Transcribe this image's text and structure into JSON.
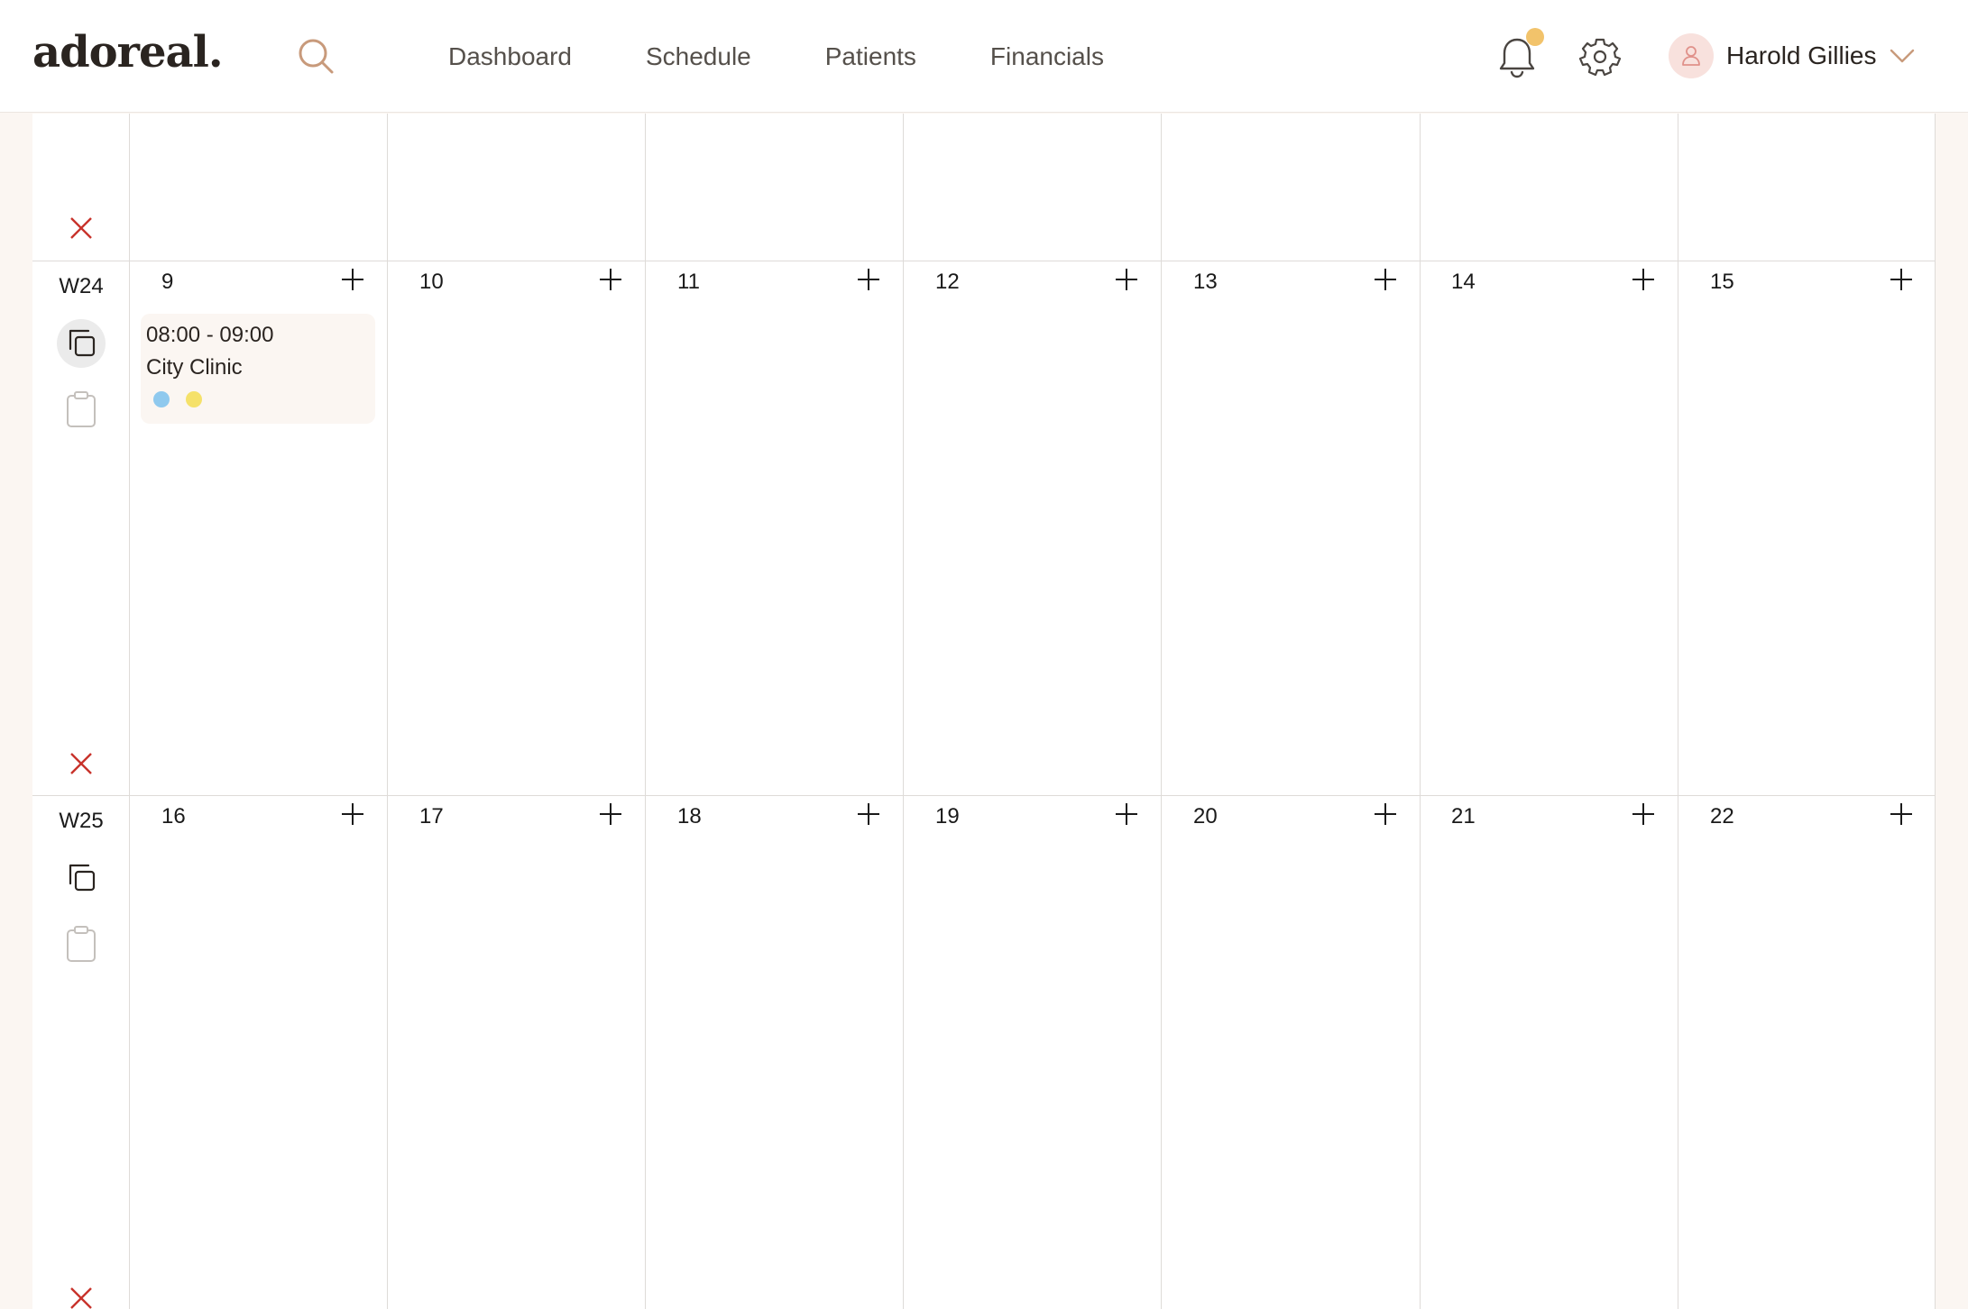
{
  "app": {
    "logo": "adoreal."
  },
  "nav": {
    "items": [
      "Dashboard",
      "Schedule",
      "Patients",
      "Financials"
    ]
  },
  "user": {
    "name": "Harold Gillies"
  },
  "colors": {
    "accent": "#f2c36b",
    "delete": "#c8322b",
    "search": "#c89a7b",
    "dot_blue": "#8fc9ee",
    "dot_yellow": "#f5e16a"
  },
  "calendar": {
    "weeks": [
      {
        "label": "W24",
        "days": [
          "9",
          "10",
          "11",
          "12",
          "13",
          "14",
          "15"
        ]
      },
      {
        "label": "W25",
        "days": [
          "16",
          "17",
          "18",
          "19",
          "20",
          "21",
          "22"
        ]
      }
    ]
  },
  "event": {
    "time": "08:00 - 09:00",
    "place": "City Clinic",
    "dots": [
      "#8fc9ee",
      "#f5e16a"
    ]
  }
}
